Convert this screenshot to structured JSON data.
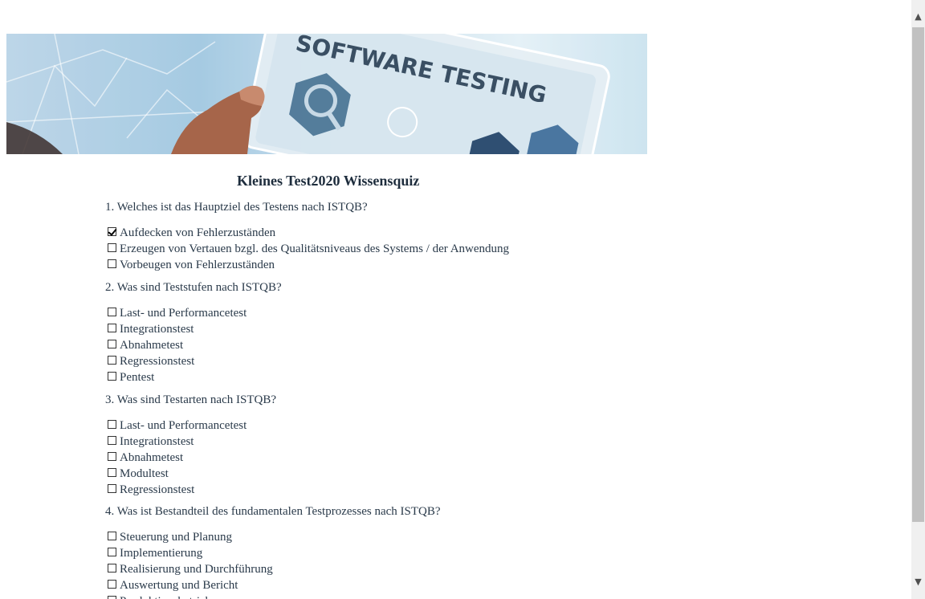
{
  "banner": {
    "text": "SOFTWARE TESTING"
  },
  "quiz": {
    "title": "Kleines Test2020 Wissensquiz",
    "questions": [
      {
        "text": "1. Welches ist das Hauptziel des Testens nach ISTQB?",
        "options": [
          {
            "label": "Aufdecken von Fehlerzuständen",
            "checked": true
          },
          {
            "label": "Erzeugen von Vertauen bzgl. des Qualitätsniveaus des Systems / der Anwendung",
            "checked": false
          },
          {
            "label": "Vorbeugen von Fehlerzuständen",
            "checked": false
          }
        ]
      },
      {
        "text": "2. Was sind Teststufen nach ISTQB?",
        "options": [
          {
            "label": "Last- und Performancetest",
            "checked": false
          },
          {
            "label": "Integrationstest",
            "checked": false
          },
          {
            "label": "Abnahmetest",
            "checked": false
          },
          {
            "label": "Regressionstest",
            "checked": false
          },
          {
            "label": "Pentest",
            "checked": false
          }
        ]
      },
      {
        "text": "3. Was sind Testarten nach ISTQB?",
        "options": [
          {
            "label": "Last- und Performancetest",
            "checked": false
          },
          {
            "label": "Integrationstest",
            "checked": false
          },
          {
            "label": "Abnahmetest",
            "checked": false
          },
          {
            "label": "Modultest",
            "checked": false
          },
          {
            "label": "Regressionstest",
            "checked": false
          }
        ]
      },
      {
        "text": "4. Was ist Bestandteil des fundamentalen Testprozesses nach ISTQB?",
        "options": [
          {
            "label": "Steuerung und Planung",
            "checked": false
          },
          {
            "label": "Implementierung",
            "checked": false
          },
          {
            "label": "Realisierung und Durchführung",
            "checked": false
          },
          {
            "label": "Auswertung und Bericht",
            "checked": false
          },
          {
            "label": "Produktionsbetrieb",
            "checked": false
          }
        ]
      }
    ]
  },
  "scrollbar": {
    "up_icon": "chevron-up-icon",
    "down_icon": "chevron-down-icon"
  }
}
